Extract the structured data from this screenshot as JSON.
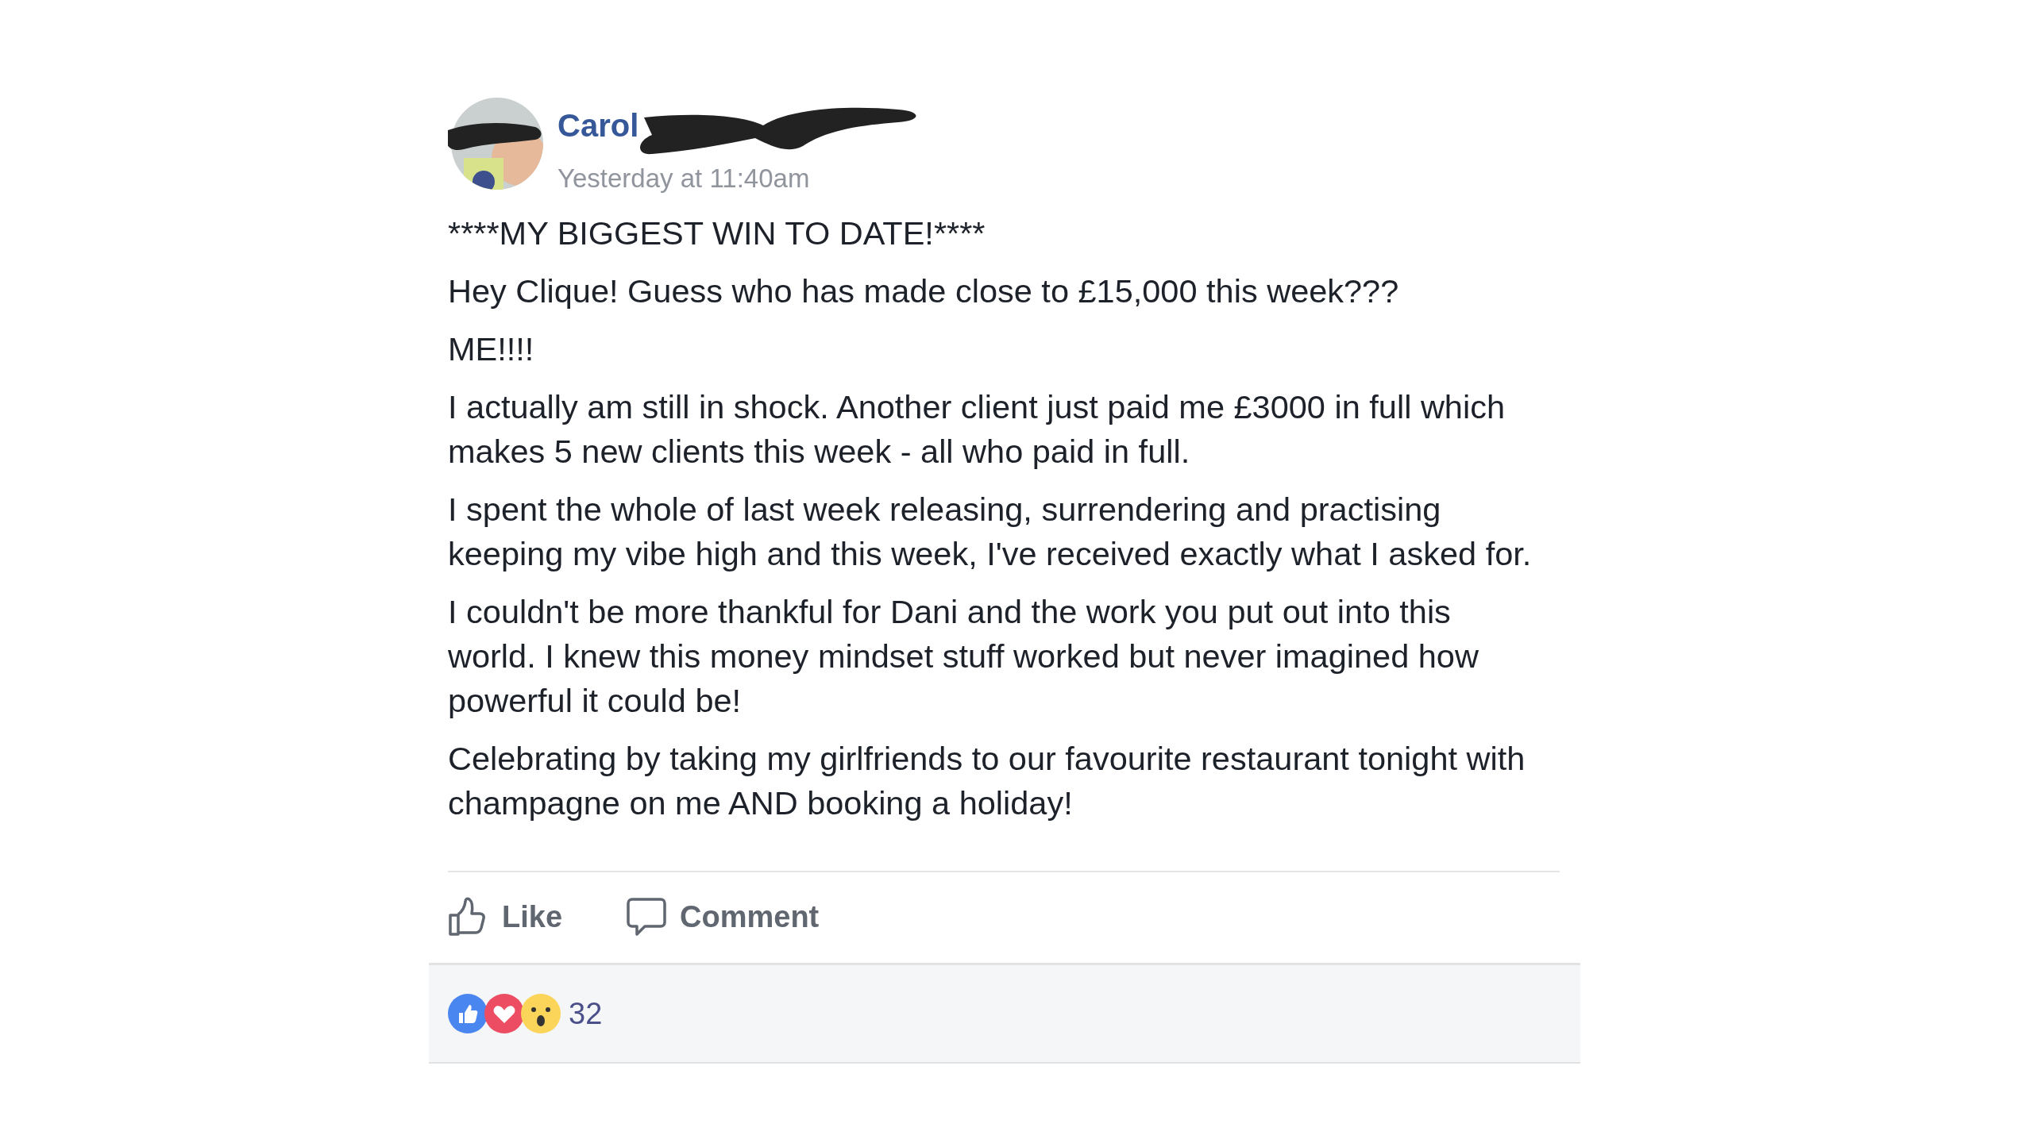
{
  "post": {
    "author_name": "Carol",
    "timestamp": "Yesterday at 11:40am",
    "paragraphs": [
      "****MY BIGGEST WIN TO DATE!****",
      "Hey Clique! Guess who has made close to £15,000 this week???",
      "ME!!!!",
      "I actually am still in shock. Another client just paid me £3000 in full which makes 5 new clients this week - all who paid in full.",
      "I spent the whole of last week releasing, surrendering and practising keeping my vibe high and this week, I've received exactly what I asked for.",
      "I couldn't be more thankful for Dani and the work you put out into this world. I knew this money mindset stuff worked but never imagined how powerful it could be!",
      "Celebrating by taking my girlfriends to our favourite restaurant tonight with champagne on me AND booking a holiday!"
    ]
  },
  "actions": [
    {
      "kind": "like",
      "label": "Like"
    },
    {
      "kind": "comment",
      "label": "Comment"
    }
  ],
  "reactions": {
    "items": [
      {
        "kind": "like"
      },
      {
        "kind": "love"
      },
      {
        "kind": "wow"
      }
    ],
    "count": "32"
  }
}
